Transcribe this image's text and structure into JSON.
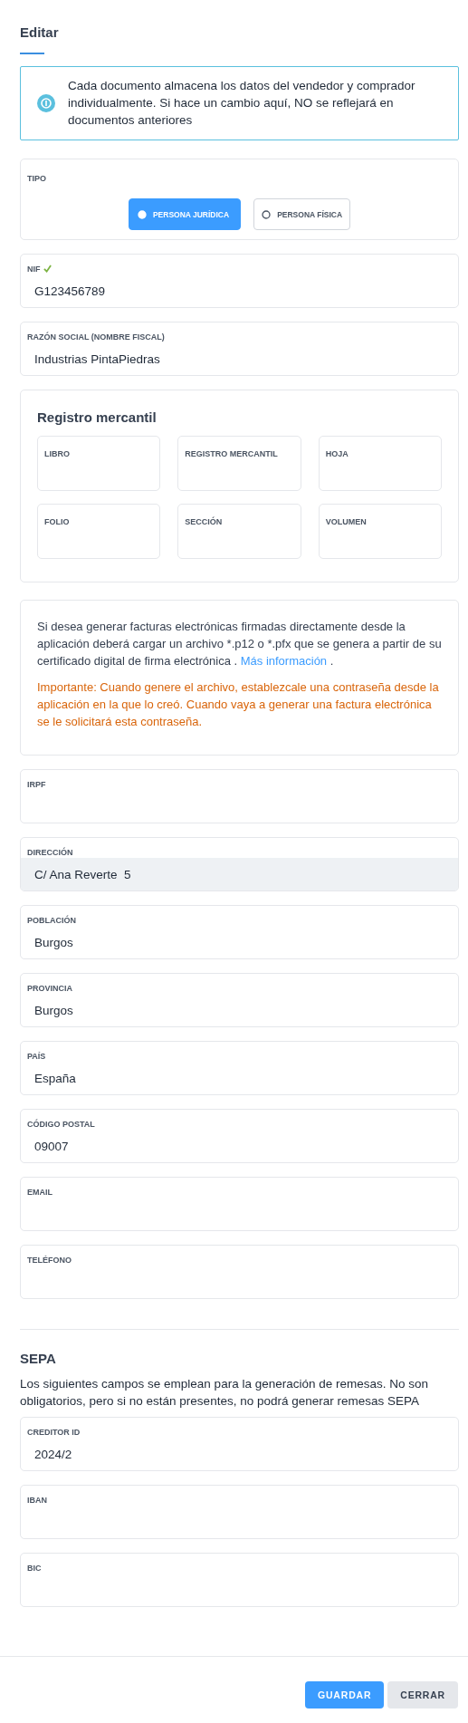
{
  "title": "Editar",
  "info": {
    "text": "Cada documento almacena los datos del vendedor y comprador individualmente. Si hace un cambio aquí, NO se reflejará en documentos anteriores"
  },
  "tipo": {
    "label": "TIPO",
    "options": [
      {
        "label": "PERSONA JURÍDICA",
        "selected": true
      },
      {
        "label": "PERSONA FÍSICA",
        "selected": false
      }
    ]
  },
  "fields_top": [
    {
      "label": "NIF",
      "value": "G123456789",
      "valid": true,
      "disabled": false
    },
    {
      "label": "RAZÓN SOCIAL (NOMBRE FISCAL)",
      "value": "Industrias PintaPiedras",
      "valid": false,
      "disabled": false
    }
  ],
  "registro": {
    "title": "Registro mercantil",
    "fields": [
      {
        "label": "LIBRO"
      },
      {
        "label": "REGISTRO MERCANTIL"
      },
      {
        "label": "HOJA"
      },
      {
        "label": "FOLIO"
      },
      {
        "label": "SECCIÓN"
      },
      {
        "label": "VOLUMEN"
      }
    ]
  },
  "einvoice": {
    "text": "Si desea generar facturas electrónicas firmadas directamente desde la aplicación deberá cargar un archivo *.p12 o *.pfx que se genera a partir de su certificado digital de firma electrónica .",
    "link": "Más información",
    "after_link": ".",
    "warning": "Importante: Cuando genere el archivo, establezcale una contraseña desde la aplicación en la que lo creó. Cuando vaya a generar una factura electrónica se le solicitará esta contraseña."
  },
  "fields": [
    {
      "label": "IRPF",
      "disabled": false
    },
    {
      "label": "DIRECCIÓN",
      "value": "C/ Ana Reverte  5",
      "disabled": true
    },
    {
      "label": "POBLACIÓN",
      "value": "Burgos",
      "disabled": false
    },
    {
      "label": "PROVINCIA",
      "value": "Burgos",
      "disabled": false
    },
    {
      "label": "PAÍS",
      "value": "España",
      "disabled": false
    },
    {
      "label": "CÓDIGO POSTAL",
      "value": "09007",
      "disabled": false
    },
    {
      "label": "EMAIL",
      "disabled": false
    },
    {
      "label": "TELÉFONO",
      "disabled": false
    }
  ],
  "sepa": {
    "title": "SEPA",
    "description": "Los siguientes campos se emplean para la generación de remesas. No son obligatorios, pero si no están presentes, no podrá generar remesas SEPA",
    "fields": [
      {
        "label": "CREDITOR ID",
        "value": "2024/2",
        "disabled": false
      },
      {
        "label": "IBAN",
        "disabled": false
      },
      {
        "label": "BIC",
        "disabled": false
      }
    ]
  },
  "buttons": [
    {
      "label": "GUARDAR",
      "kind": "primary"
    },
    {
      "label": "CERRAR",
      "kind": "secondary"
    }
  ]
}
